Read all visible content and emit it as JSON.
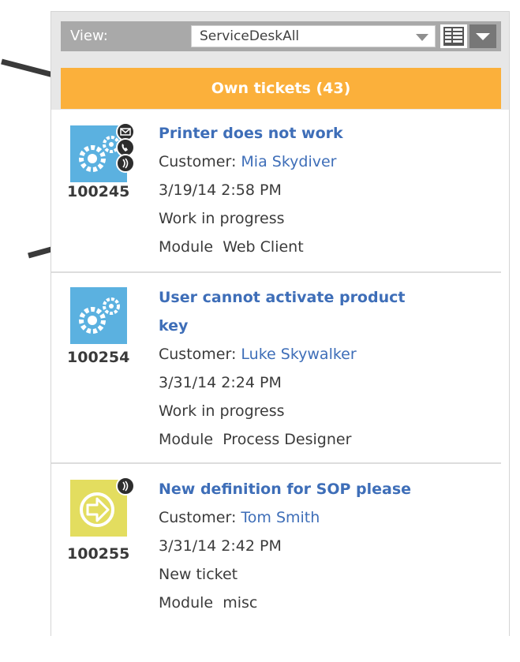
{
  "toolbar": {
    "view_label": "View:",
    "view_value": "ServiceDeskAll"
  },
  "section": {
    "title": "Own tickets (43)",
    "color": "#fbb03b"
  },
  "tickets": [
    {
      "id": "100245",
      "title": "Printer does not work",
      "customer_label": "Customer:",
      "customer_name": "Mia Skydiver",
      "datetime": "3/19/14 2:58 PM",
      "status": "Work in progress",
      "module_label": "Module",
      "module": "Web Client",
      "icon": "gears-icon",
      "badges": [
        "email-icon",
        "phone-icon",
        "sound-icon"
      ]
    },
    {
      "id": "100254",
      "title_line1": "User cannot activate product",
      "title_line2": "key",
      "customer_label": "Customer:",
      "customer_name": "Luke Skywalker",
      "datetime": "3/31/14 2:24 PM",
      "status": "Work in progress",
      "module_label": "Module",
      "module": "Process Designer",
      "icon": "gears-icon",
      "badges": []
    },
    {
      "id": "100255",
      "title": "New definition for SOP please",
      "customer_label": "Customer:",
      "customer_name": "Tom Smith",
      "datetime": "3/31/14 2:42 PM",
      "status": "New ticket",
      "module_label": "Module",
      "module": "misc",
      "icon": "arrow-right-circle-icon",
      "badges": [
        "sound-icon"
      ]
    }
  ],
  "colors": {
    "link": "#3e6eb8",
    "gear_tile": "#5bb1e0",
    "new_tile": "#e3dd5f"
  }
}
